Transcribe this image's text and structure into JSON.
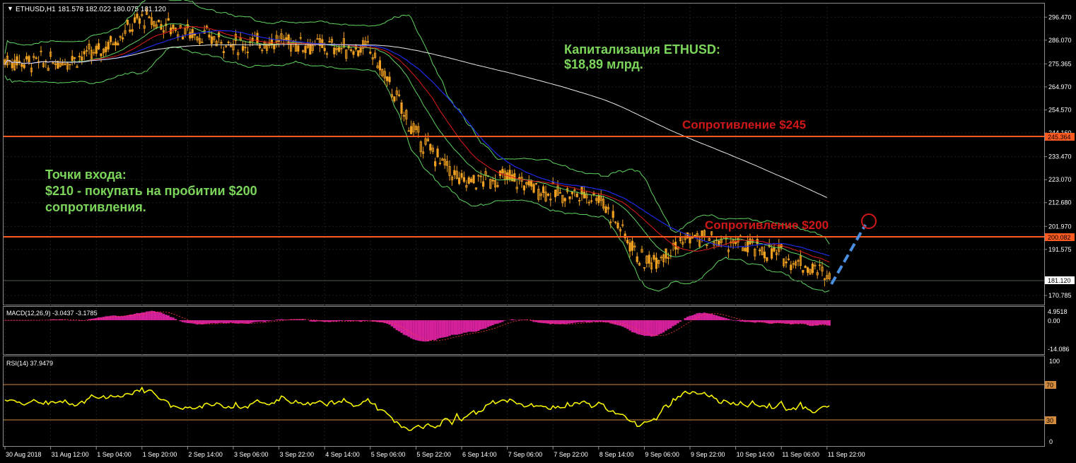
{
  "header": {
    "symbol": "ETHUSD,H1",
    "ohlc": "181.578 182.022 180.075 181.120"
  },
  "annotations": {
    "cap_line1": "Капитализация ETHUSD:",
    "cap_line2": "$18,89 млрд.",
    "res245": "Сопротивление $245",
    "res200": "Сопротивление $200",
    "entry_line1": "Точки входа:",
    "entry_line2": "$210 - покупать на пробитии $200",
    "entry_line3": "сопротивления."
  },
  "colors": {
    "candle": "#f0a020",
    "bollinger": "#5fd35f",
    "ma_red": "#e01a1a",
    "ma_blue": "#1e2ae8",
    "ma_white": "#e8e8e8",
    "resistance": "#ff5a1f",
    "annotation_green": "#7bd65a",
    "annotation_red": "#d01818",
    "macd": "#d4209a",
    "rsi": "#ffff00",
    "forecast": "#4a8ee0"
  },
  "price_axis": {
    "ticks": [
      "296.470",
      "286.070",
      "275.365",
      "264.970",
      "254.570",
      "244.160",
      "233.470",
      "223.070",
      "212.680",
      "201.970",
      "191.575",
      "170.785"
    ],
    "current_price": "181.120",
    "level_245": "245.364",
    "level_200": "200.082"
  },
  "macd": {
    "label": "MACD(12,26,9) -3.0437 -3.1785",
    "ticks": [
      "4.9518",
      "0.00",
      "-14.086"
    ]
  },
  "rsi": {
    "label": "RSI(14) 37.9479",
    "ticks": [
      "100",
      "70",
      "30",
      "0"
    ]
  },
  "time_axis": [
    "30 Aug 2018",
    "31 Aug 12:00",
    "1 Sep 04:00",
    "1 Sep 20:00",
    "2 Sep 14:00",
    "3 Sep 06:00",
    "3 Sep 22:00",
    "4 Sep 14:00",
    "5 Sep 06:00",
    "5 Sep 22:00",
    "6 Sep 14:00",
    "7 Sep 06:00",
    "7 Sep 22:00",
    "8 Sep 14:00",
    "9 Sep 06:00",
    "9 Sep 22:00",
    "10 Sep 14:00",
    "11 Sep 06:00",
    "11 Sep 22:00"
  ],
  "chart_data": {
    "type": "line",
    "title": "ETHUSD,H1",
    "ylim": [
      165,
      302
    ],
    "resistance_levels": [
      245.364,
      200.082
    ],
    "current_price": 181.12,
    "close_path": [
      {
        "t": "30 Aug 2018",
        "y": 277
      },
      {
        "t": "31 Aug 12:00",
        "y": 276
      },
      {
        "t": "1 Sep 04:00",
        "y": 280
      },
      {
        "t": "1 Sep 20:00",
        "y": 296
      },
      {
        "t": "2 Sep 14:00",
        "y": 290
      },
      {
        "t": "3 Sep 06:00",
        "y": 284
      },
      {
        "t": "3 Sep 22:00",
        "y": 286
      },
      {
        "t": "4 Sep 14:00",
        "y": 283
      },
      {
        "t": "5 Sep 06:00",
        "y": 282
      },
      {
        "t": "5 Sep 22:00",
        "y": 243
      },
      {
        "t": "6 Sep 14:00",
        "y": 222
      },
      {
        "t": "7 Sep 06:00",
        "y": 224
      },
      {
        "t": "7 Sep 22:00",
        "y": 217
      },
      {
        "t": "8 Sep 14:00",
        "y": 216
      },
      {
        "t": "9 Sep 06:00",
        "y": 185
      },
      {
        "t": "9 Sep 22:00",
        "y": 197
      },
      {
        "t": "10 Sep 14:00",
        "y": 194
      },
      {
        "t": "11 Sep 06:00",
        "y": 189
      },
      {
        "t": "11 Sep 22:00",
        "y": 181
      }
    ]
  }
}
